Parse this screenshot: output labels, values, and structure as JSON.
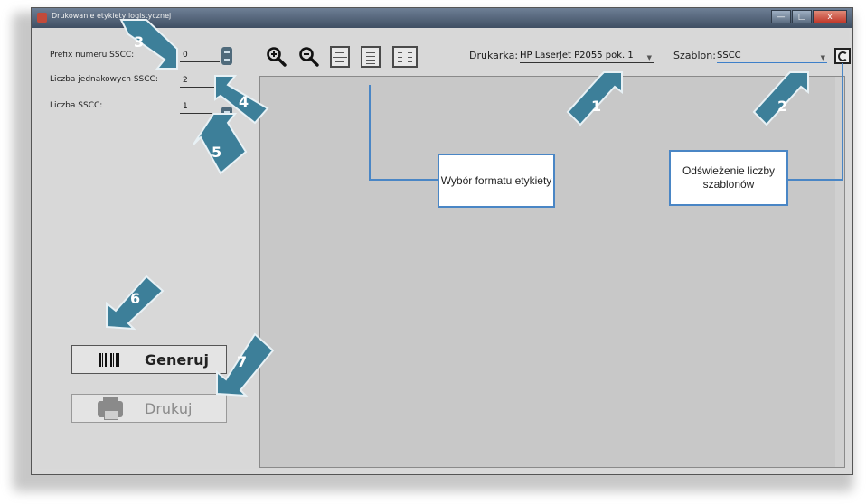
{
  "window": {
    "title": "Drukowanie etykiety logistycznej",
    "buttons": {
      "minimize": "—",
      "maximize": "□",
      "close": "x"
    }
  },
  "form": {
    "prefix_label": "Prefix numeru SSCC:",
    "prefix_value": "0",
    "identical_label": "Liczba jednakowych SSCC:",
    "identical_value": "2",
    "count_label": "Liczba SSCC:",
    "count_value": "1"
  },
  "toolbar": {
    "zoom_in": "zoom-in-icon",
    "zoom_out": "zoom-out-icon",
    "format_icons": [
      "format-fit-width-icon",
      "format-single-page-icon",
      "format-two-pages-icon"
    ],
    "printer_label": "Drukarka:",
    "printer_value": "HP LaserJet P2055 pok. 1",
    "template_label": "Szablon:",
    "template_value": "SSCC"
  },
  "actions": {
    "generate_label": "Generuj",
    "print_label": "Drukuj"
  },
  "callouts": {
    "format": "Wybór formatu etykiety",
    "refresh": "Odświeżenie liczby szablonów"
  },
  "markers": [
    "1",
    "2",
    "3",
    "4",
    "5",
    "6",
    "7"
  ],
  "colors": {
    "arrow": "#3d7f99",
    "callout_border": "#4a86c5"
  }
}
